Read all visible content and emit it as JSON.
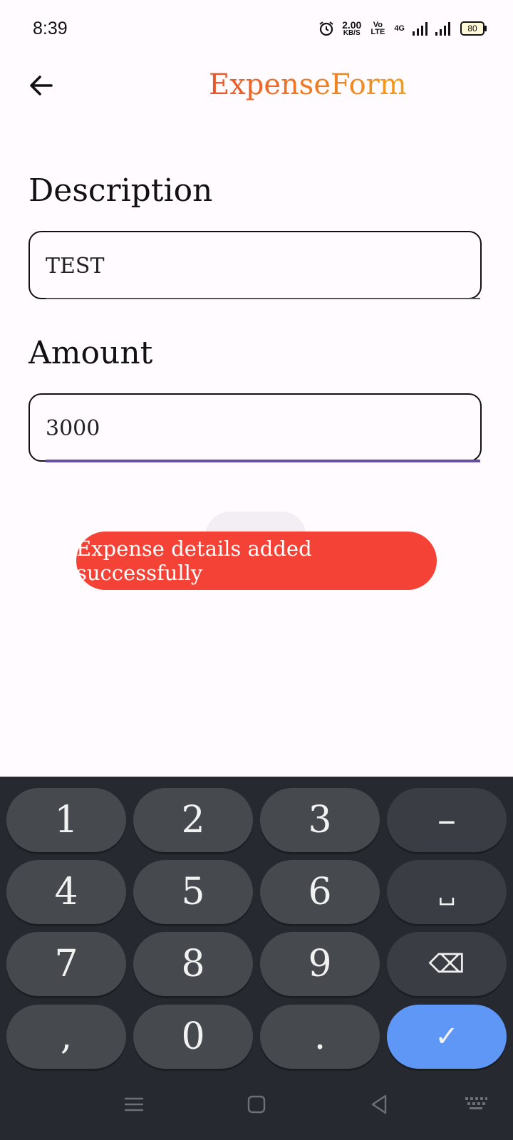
{
  "status_bar": {
    "time": "8:39",
    "net_speed_value": "2.00",
    "net_speed_unit": "KB/S",
    "volte": "Vo LTE",
    "network_type": "4G",
    "battery": "80"
  },
  "app_bar": {
    "title": "ExpenseForm"
  },
  "form": {
    "description_label": "Description",
    "description_value": "TEST",
    "amount_label": "Amount",
    "amount_value": "3000"
  },
  "snackbar": {
    "message": "Expense details added successfully",
    "color": "#f44336"
  },
  "keyboard": {
    "keys": [
      "1",
      "2",
      "3",
      "–",
      "4",
      "5",
      "6",
      "␣",
      "7",
      "8",
      "9",
      "⌫",
      ",",
      "0",
      ".",
      "✓"
    ],
    "enter_color": "#5e97f6"
  },
  "colors": {
    "title_gradient_start": "#e8542b",
    "title_gradient_end": "#f29d1a",
    "focus_underline": "#6750a4",
    "background": "#fffbfe"
  }
}
